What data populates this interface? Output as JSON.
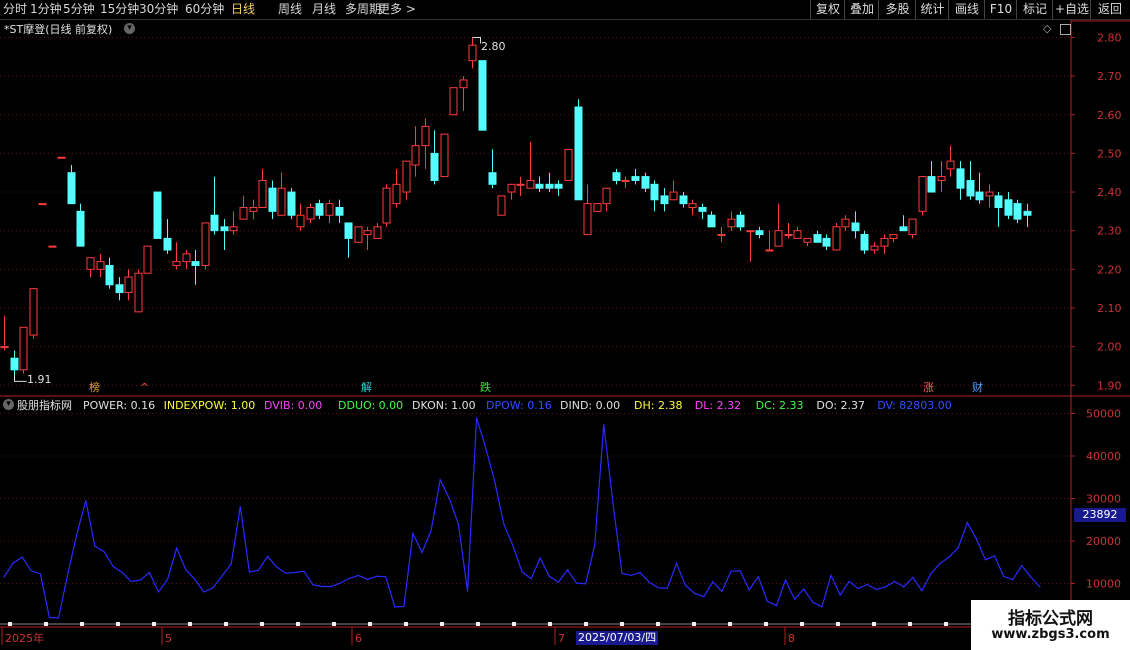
{
  "toolbar": {
    "periods": [
      "分时",
      "1分钟",
      "5分钟",
      "15分钟",
      "30分钟",
      "60分钟",
      "日线",
      "周线",
      "月线",
      "多周期",
      "更多 >"
    ],
    "active_period": "日线",
    "right_buttons": [
      "复权",
      "叠加",
      "多股",
      "统计",
      "画线",
      "F10",
      "标记",
      "+自选",
      "返回"
    ]
  },
  "main_panel": {
    "title": "*ST摩登(日线 前复权)",
    "high_label": "2.80",
    "low_label": "1.91",
    "badges": [
      {
        "text": "榜",
        "color": "#e0a030"
      },
      {
        "text": "^",
        "color": "#ff5050"
      },
      {
        "text": "解",
        "color": "#30d0d0"
      },
      {
        "text": "跌",
        "color": "#40e040"
      },
      {
        "text": "涨",
        "color": "#ff6060"
      },
      {
        "text": "财",
        "color": "#5aa0ff"
      }
    ]
  },
  "indicator_panel": {
    "name": "股朋指标网",
    "items": [
      {
        "text": "POWER: 0.16",
        "color": "#e0e0e0"
      },
      {
        "text": "INDEXPOW: 1.00",
        "color": "#ffff40"
      },
      {
        "text": "DVIB: 0.00",
        "color": "#ff40ff"
      },
      {
        "text": "DDUO: 0.00",
        "color": "#40ff40"
      },
      {
        "text": "DKON: 1.00",
        "color": "#e0e0e0"
      },
      {
        "text": "DPOW: 0.16",
        "color": "#3050ff"
      },
      {
        "text": "DIND: 0.00",
        "color": "#e0e0e0"
      },
      {
        "text": "DH: 2.38",
        "color": "#ffff40"
      },
      {
        "text": "DL: 2.32",
        "color": "#ff40ff"
      },
      {
        "text": "DC: 2.33",
        "color": "#40ff40"
      },
      {
        "text": "DO: 2.37",
        "color": "#e0e0e0"
      },
      {
        "text": "DV: 82803.00",
        "color": "#3050ff"
      }
    ],
    "current_value": "23892"
  },
  "date_axis": {
    "labels": [
      "2025年",
      "5",
      "6",
      "7",
      "8"
    ],
    "cursor_date": "2025/07/03/四"
  },
  "watermark": {
    "line1": "指标公式网",
    "line2": "www.zbgs3.com"
  },
  "colors": {
    "up": "#ff3c3c",
    "down": "#54ffff",
    "axis": "#b02020",
    "grid": "#5a1010",
    "line": "#2a2aff"
  },
  "chart_data": [
    {
      "type": "candlestick",
      "title": "*ST摩登(日线 前复权)",
      "y_ticks": [
        2.8,
        2.7,
        2.6,
        2.5,
        2.4,
        2.3,
        2.2,
        2.1,
        2.0,
        1.9
      ],
      "ylim": [
        1.88,
        2.84
      ],
      "ohlc": [
        [
          2.0,
          2.08,
          1.99,
          2.0
        ],
        [
          1.97,
          1.99,
          1.91,
          1.94
        ],
        [
          1.94,
          2.05,
          1.93,
          2.05
        ],
        [
          2.03,
          2.15,
          2.02,
          2.15
        ],
        [
          2.37,
          2.37,
          2.37,
          2.37
        ],
        [
          2.26,
          2.26,
          2.26,
          2.26
        ],
        [
          2.49,
          2.49,
          2.49,
          2.49
        ],
        [
          2.45,
          2.47,
          2.37,
          2.37
        ],
        [
          2.35,
          2.37,
          2.26,
          2.26
        ],
        [
          2.2,
          2.23,
          2.18,
          2.23
        ],
        [
          2.2,
          2.24,
          2.18,
          2.22
        ],
        [
          2.21,
          2.23,
          2.15,
          2.16
        ],
        [
          2.16,
          2.18,
          2.12,
          2.14
        ],
        [
          2.14,
          2.2,
          2.12,
          2.18
        ],
        [
          2.09,
          2.2,
          2.09,
          2.19
        ],
        [
          2.19,
          2.26,
          2.19,
          2.26
        ],
        [
          2.4,
          2.4,
          2.28,
          2.28
        ],
        [
          2.28,
          2.33,
          2.24,
          2.25
        ],
        [
          2.21,
          2.27,
          2.2,
          2.22
        ],
        [
          2.22,
          2.25,
          2.2,
          2.24
        ],
        [
          2.22,
          2.25,
          2.16,
          2.21
        ],
        [
          2.21,
          2.32,
          2.2,
          2.32
        ],
        [
          2.34,
          2.44,
          2.29,
          2.3
        ],
        [
          2.31,
          2.33,
          2.25,
          2.3
        ],
        [
          2.3,
          2.35,
          2.29,
          2.31
        ],
        [
          2.33,
          2.39,
          2.33,
          2.36
        ],
        [
          2.35,
          2.38,
          2.33,
          2.36
        ],
        [
          2.36,
          2.46,
          2.36,
          2.43
        ],
        [
          2.41,
          2.43,
          2.33,
          2.35
        ],
        [
          2.34,
          2.45,
          2.34,
          2.41
        ],
        [
          2.4,
          2.41,
          2.33,
          2.34
        ],
        [
          2.31,
          2.37,
          2.3,
          2.34
        ],
        [
          2.33,
          2.37,
          2.32,
          2.36
        ],
        [
          2.37,
          2.38,
          2.33,
          2.34
        ],
        [
          2.34,
          2.38,
          2.32,
          2.37
        ],
        [
          2.36,
          2.38,
          2.32,
          2.34
        ],
        [
          2.32,
          2.32,
          2.23,
          2.28
        ],
        [
          2.27,
          2.31,
          2.27,
          2.31
        ],
        [
          2.29,
          2.31,
          2.25,
          2.3
        ],
        [
          2.28,
          2.32,
          2.28,
          2.31
        ],
        [
          2.32,
          2.42,
          2.31,
          2.41
        ],
        [
          2.37,
          2.46,
          2.36,
          2.42
        ],
        [
          2.4,
          2.48,
          2.38,
          2.48
        ],
        [
          2.47,
          2.57,
          2.44,
          2.52
        ],
        [
          2.52,
          2.59,
          2.46,
          2.57
        ],
        [
          2.5,
          2.56,
          2.42,
          2.43
        ],
        [
          2.44,
          2.55,
          2.44,
          2.55
        ],
        [
          2.6,
          2.62,
          2.6,
          2.67
        ],
        [
          2.67,
          2.7,
          2.61,
          2.69
        ],
        [
          2.74,
          2.8,
          2.72,
          2.78
        ],
        [
          2.74,
          2.74,
          2.56,
          2.56
        ],
        [
          2.45,
          2.51,
          2.41,
          2.42
        ],
        [
          2.34,
          2.39,
          2.34,
          2.39
        ],
        [
          2.4,
          2.42,
          2.38,
          2.42
        ],
        [
          2.42,
          2.44,
          2.39,
          2.42
        ],
        [
          2.41,
          2.53,
          2.41,
          2.43
        ],
        [
          2.42,
          2.44,
          2.4,
          2.41
        ],
        [
          2.42,
          2.45,
          2.4,
          2.41
        ],
        [
          2.42,
          2.43,
          2.39,
          2.41
        ],
        [
          2.43,
          2.51,
          2.43,
          2.51
        ],
        [
          2.62,
          2.64,
          2.38,
          2.38
        ],
        [
          2.29,
          2.42,
          2.29,
          2.37
        ],
        [
          2.35,
          2.37,
          2.35,
          2.37
        ],
        [
          2.37,
          2.41,
          2.35,
          2.41
        ],
        [
          2.45,
          2.46,
          2.42,
          2.43
        ],
        [
          2.43,
          2.44,
          2.41,
          2.43
        ],
        [
          2.44,
          2.46,
          2.42,
          2.43
        ],
        [
          2.44,
          2.45,
          2.4,
          2.41
        ],
        [
          2.42,
          2.43,
          2.35,
          2.38
        ],
        [
          2.39,
          2.41,
          2.35,
          2.37
        ],
        [
          2.38,
          2.43,
          2.38,
          2.4
        ],
        [
          2.39,
          2.4,
          2.36,
          2.37
        ],
        [
          2.36,
          2.38,
          2.34,
          2.37
        ],
        [
          2.36,
          2.37,
          2.33,
          2.35
        ],
        [
          2.34,
          2.35,
          2.31,
          2.31
        ],
        [
          2.29,
          2.31,
          2.27,
          2.29
        ],
        [
          2.31,
          2.35,
          2.3,
          2.33
        ],
        [
          2.34,
          2.35,
          2.3,
          2.31
        ],
        [
          2.3,
          2.3,
          2.22,
          2.3
        ],
        [
          2.3,
          2.31,
          2.28,
          2.29
        ],
        [
          2.25,
          2.3,
          2.25,
          2.25
        ],
        [
          2.26,
          2.37,
          2.26,
          2.3
        ],
        [
          2.29,
          2.32,
          2.28,
          2.29
        ],
        [
          2.28,
          2.31,
          2.28,
          2.3
        ],
        [
          2.27,
          2.28,
          2.26,
          2.28
        ],
        [
          2.29,
          2.3,
          2.27,
          2.27
        ],
        [
          2.28,
          2.29,
          2.25,
          2.26
        ],
        [
          2.25,
          2.32,
          2.25,
          2.31
        ],
        [
          2.31,
          2.34,
          2.3,
          2.33
        ],
        [
          2.32,
          2.35,
          2.28,
          2.3
        ],
        [
          2.29,
          2.3,
          2.24,
          2.25
        ],
        [
          2.25,
          2.27,
          2.24,
          2.26
        ],
        [
          2.26,
          2.29,
          2.24,
          2.28
        ],
        [
          2.28,
          2.29,
          2.27,
          2.29
        ],
        [
          2.31,
          2.34,
          2.3,
          2.3
        ],
        [
          2.29,
          2.33,
          2.28,
          2.33
        ],
        [
          2.35,
          2.44,
          2.34,
          2.44
        ],
        [
          2.44,
          2.48,
          2.4,
          2.4
        ],
        [
          2.43,
          2.48,
          2.4,
          2.44
        ],
        [
          2.46,
          2.52,
          2.44,
          2.48
        ],
        [
          2.46,
          2.48,
          2.38,
          2.41
        ],
        [
          2.43,
          2.48,
          2.38,
          2.39
        ],
        [
          2.4,
          2.45,
          2.37,
          2.38
        ],
        [
          2.39,
          2.42,
          2.36,
          2.4
        ],
        [
          2.39,
          2.4,
          2.31,
          2.36
        ],
        [
          2.38,
          2.4,
          2.33,
          2.34
        ],
        [
          2.37,
          2.38,
          2.32,
          2.33
        ],
        [
          2.35,
          2.37,
          2.31,
          2.34
        ]
      ]
    },
    {
      "type": "line",
      "y_ticks": [
        50000,
        40000,
        30000,
        20000,
        10000
      ],
      "ylim": [
        0,
        52000
      ],
      "values": [
        11500,
        14800,
        16200,
        13000,
        12300,
        2000,
        1900,
        12000,
        21500,
        29500,
        18800,
        17500,
        14000,
        12600,
        10500,
        10800,
        12600,
        8000,
        11000,
        18300,
        13300,
        11000,
        8000,
        9000,
        11800,
        14600,
        28100,
        12700,
        13100,
        16400,
        13900,
        12400,
        12600,
        12900,
        9700,
        9300,
        9300,
        10100,
        11200,
        11900,
        11000,
        11700,
        11600,
        4500,
        4600,
        21800,
        17300,
        22500,
        34400,
        30000,
        24000,
        8200,
        49000,
        42000,
        34000,
        24000,
        18900,
        12800,
        11100,
        16000,
        11700,
        10300,
        13200,
        10100,
        9900,
        19000,
        47400,
        29000,
        12400,
        11900,
        12600,
        10300,
        9000,
        8900,
        14700,
        9500,
        7700,
        6900,
        10400,
        8100,
        12900,
        13000,
        8500,
        11600,
        5800,
        4800,
        10800,
        6300,
        8700,
        5600,
        4500,
        11900,
        7300,
        10500,
        8800,
        9800,
        8600,
        9200,
        10500,
        9200,
        11400,
        8300,
        12300,
        14700,
        16200,
        18400,
        24300,
        20500,
        15600,
        16500,
        11700,
        10900,
        14200,
        11500,
        9200
      ]
    }
  ]
}
